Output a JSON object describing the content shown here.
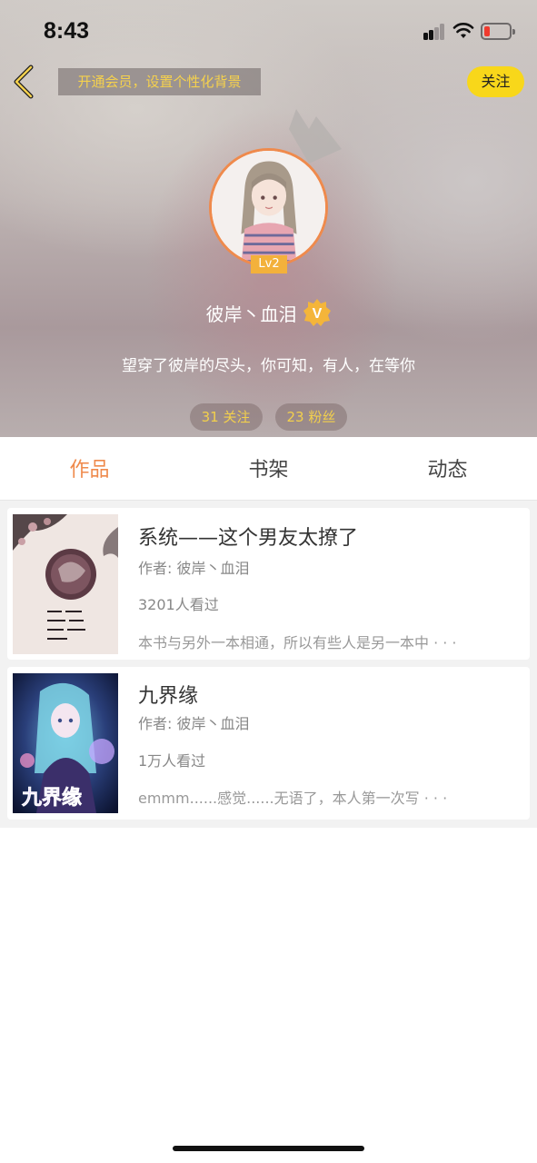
{
  "status_bar": {
    "time": "8:43"
  },
  "header": {
    "vip_banner": "开通会员，设置个性化背景",
    "follow_label": "关注",
    "level": "Lv2",
    "username": "彼岸丶血泪",
    "verified_mark": "V",
    "signature": "望穿了彼岸的尽头，你可知，有人，在等你",
    "stats": {
      "following": "31 关注",
      "fans": "23 粉丝"
    }
  },
  "tabs": [
    {
      "label": "作品",
      "active": true
    },
    {
      "label": "书架",
      "active": false
    },
    {
      "label": "动态",
      "active": false
    }
  ],
  "books": [
    {
      "title": "系统——这个男友太撩了",
      "author": "作者: 彼岸丶血泪",
      "views": "3201人看过",
      "description": "本书与另外一本相通，所以有些人是另一本中 · · ·"
    },
    {
      "title": "九界缘",
      "author": "作者: 彼岸丶血泪",
      "views": "1万人看过",
      "description": "emmm......感觉......无语了，本人第一次写 · · ·",
      "cover_text": "九界缘"
    }
  ],
  "colors": {
    "accent": "#ef8a4c",
    "follow_button": "#f8d71a",
    "stat_text": "#f3d04c",
    "level_badge": "#f3b13b"
  },
  "icons": {
    "back": "chevron-left-icon",
    "verified": "verified-badge-icon",
    "crown": "crown-icon"
  }
}
